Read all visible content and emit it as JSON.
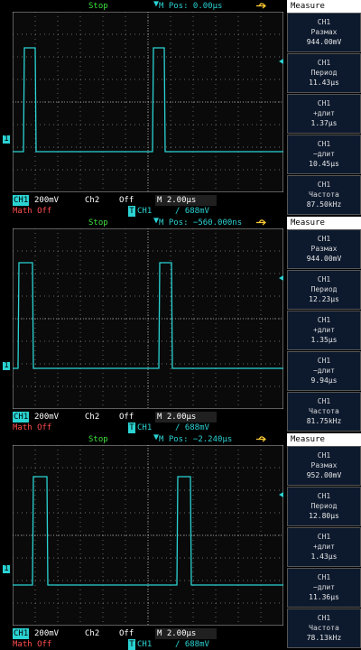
{
  "panels": [
    {
      "status": "Stop",
      "mpos": "M Pos: 0.00µs",
      "measure_title": "Measure",
      "measurements": [
        {
          "ch": "CH1",
          "label": "Размах",
          "value": "944.00mV"
        },
        {
          "ch": "CH1",
          "label": "Период",
          "value": "11.43µs"
        },
        {
          "ch": "CH1",
          "label": "+длит",
          "value": "1.37µs"
        },
        {
          "ch": "CH1",
          "label": "−длит",
          "value": "10.45µs"
        },
        {
          "ch": "CH1",
          "label": "Частота",
          "value": "87.50kHz"
        }
      ],
      "ch1_label": "CH1",
      "ch1_scale": "200mV",
      "ch2_label": "Ch2",
      "ch2_value": "Off",
      "timebase": "M 2.00µs",
      "math": "Math Off",
      "trig_source": "CH1",
      "trig_slope": "∕",
      "trig_level": "688mV"
    },
    {
      "status": "Stop",
      "mpos": "M Pos: −560.000ns",
      "measure_title": "Measure",
      "measurements": [
        {
          "ch": "CH1",
          "label": "Размах",
          "value": "944.00mV"
        },
        {
          "ch": "CH1",
          "label": "Период",
          "value": "12.23µs"
        },
        {
          "ch": "CH1",
          "label": "+длит",
          "value": "1.35µs"
        },
        {
          "ch": "CH1",
          "label": "−длит",
          "value": "9.94µs"
        },
        {
          "ch": "CH1",
          "label": "Частота",
          "value": "81.75kHz"
        }
      ],
      "ch1_label": "CH1",
      "ch1_scale": "200mV",
      "ch2_label": "Ch2",
      "ch2_value": "Off",
      "timebase": "M 2.00µs",
      "math": "Math Off",
      "trig_source": "CH1",
      "trig_slope": "∕",
      "trig_level": "688mV"
    },
    {
      "status": "Stop",
      "mpos": "M Pos: −2.240µs",
      "measure_title": "Measure",
      "measurements": [
        {
          "ch": "CH1",
          "label": "Размах",
          "value": "952.00mV"
        },
        {
          "ch": "CH1",
          "label": "Период",
          "value": "12.80µs"
        },
        {
          "ch": "CH1",
          "label": "+длит",
          "value": "1.43µs"
        },
        {
          "ch": "CH1",
          "label": "−длит",
          "value": "11.36µs"
        },
        {
          "ch": "CH1",
          "label": "Частота",
          "value": "78.13kHz"
        }
      ],
      "ch1_label": "CH1",
      "ch1_scale": "200mV",
      "ch2_label": "Ch2",
      "ch2_value": "Off",
      "timebase": "M 2.00µs",
      "math": "Math Off",
      "trig_source": "CH1",
      "trig_slope": "∕",
      "trig_level": "688mV"
    }
  ],
  "colors": {
    "trace": "#2bd3d3",
    "grid": "#8a8a8a",
    "stop": "#3ee03e",
    "math": "#ff4d4d"
  },
  "icons": {
    "usb": "usb-icon",
    "trigger": "trigger-position-icon",
    "ground": "ch1-ground-marker-icon"
  }
}
